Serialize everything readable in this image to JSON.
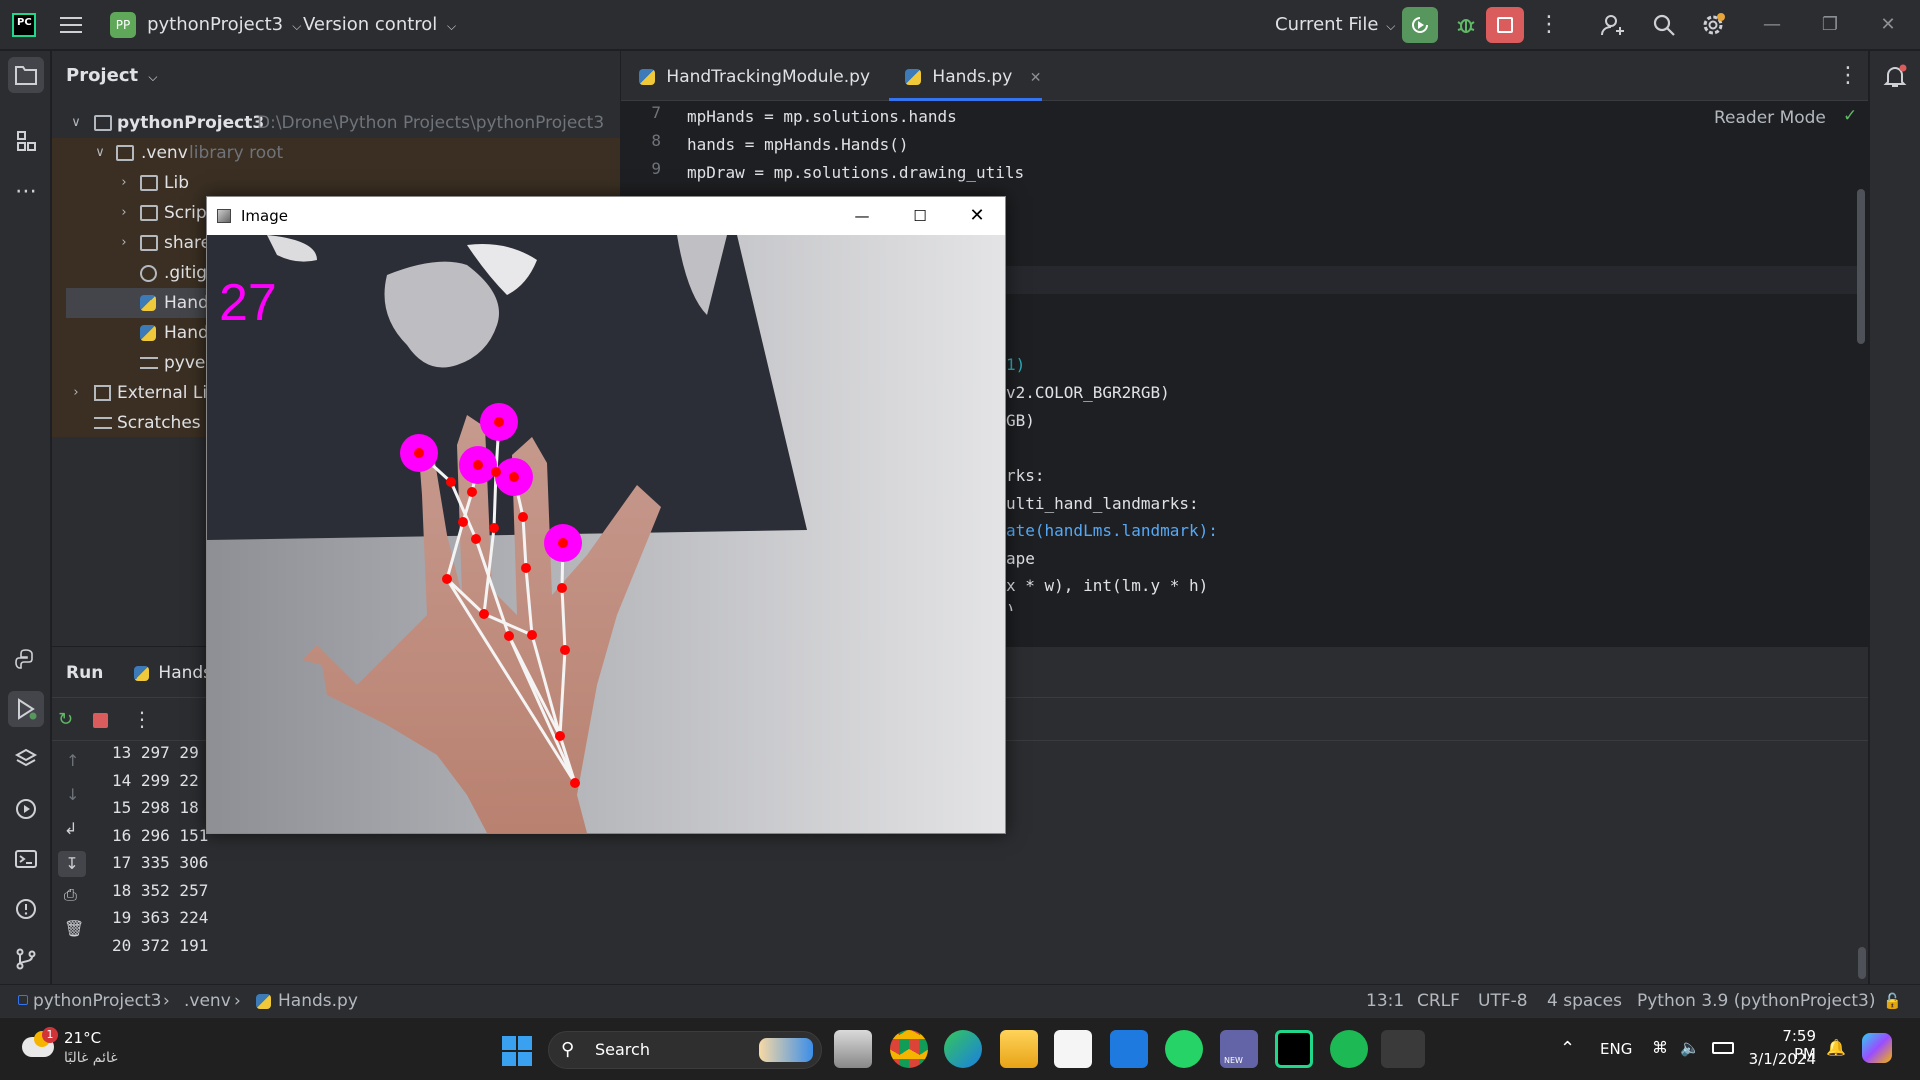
{
  "titlebar": {
    "project_badge": "PP",
    "project_name": "pythonProject3",
    "version_control": "Version control",
    "run_config": "Current File"
  },
  "project_panel": {
    "title": "Project",
    "tree": [
      {
        "label": "pythonProject3",
        "hint": "D:\\Drone\\Python Projects\\pythonProject3"
      },
      {
        "label": ".venv",
        "hint": "library root"
      },
      {
        "label": "Lib"
      },
      {
        "label": "Scripts"
      },
      {
        "label": "share"
      },
      {
        "label": ".gitignore"
      },
      {
        "label": "Hand"
      },
      {
        "label": "Hand"
      },
      {
        "label": "pyvenv"
      },
      {
        "label": "External Lib"
      },
      {
        "label": "Scratches a"
      }
    ]
  },
  "editor": {
    "tabs": [
      {
        "label": "HandTrackingModule.py"
      },
      {
        "label": "Hands.py"
      }
    ],
    "reader_mode": "Reader Mode",
    "lines": [
      {
        "num": "7",
        "text": "mpHands = mp.solutions.hands"
      },
      {
        "num": "8",
        "text": "hands = mpHands.Hands()"
      },
      {
        "num": "9",
        "text": "mpDraw = mp.solutions.drawing_utils"
      }
    ],
    "visible_fragments": [
      "1)",
      "v2.COLOR_BGR2RGB)",
      "GB)",
      "rks:",
      "ulti_hand_landmarks:",
      "ate(handLms.landmark):",
      "ape",
      "x * w), int(lm.y * h)",
      ")"
    ]
  },
  "run_panel": {
    "title": "Run",
    "tab": "Hands",
    "output": [
      "13 297 29",
      "14 299 22",
      "15 298 18",
      "16 296 151",
      "17 335 306",
      "18 352 257",
      "19 363 224",
      "20 372 191"
    ]
  },
  "image_window": {
    "title": "Image",
    "fps": "27"
  },
  "statusbar": {
    "crumbs": [
      "pythonProject3",
      ".venv",
      "Hands.py"
    ],
    "position": "13:1",
    "line_sep": "CRLF",
    "encoding": "UTF-8",
    "indent": "4 spaces",
    "interpreter": "Python 3.9 (pythonProject3)"
  },
  "taskbar": {
    "weather_temp": "21°C",
    "weather_desc": "غائم غالبًا",
    "weather_badge": "1",
    "search": "Search",
    "lang": "ENG",
    "time": "7:59 PM",
    "date": "3/1/2024",
    "teams_badge": "NEW"
  },
  "colors": {
    "accent_green": "#57965c",
    "stop_red": "#db5c5c",
    "landmark_magenta": "#ff00ff",
    "landmark_red": "#ff0000"
  }
}
